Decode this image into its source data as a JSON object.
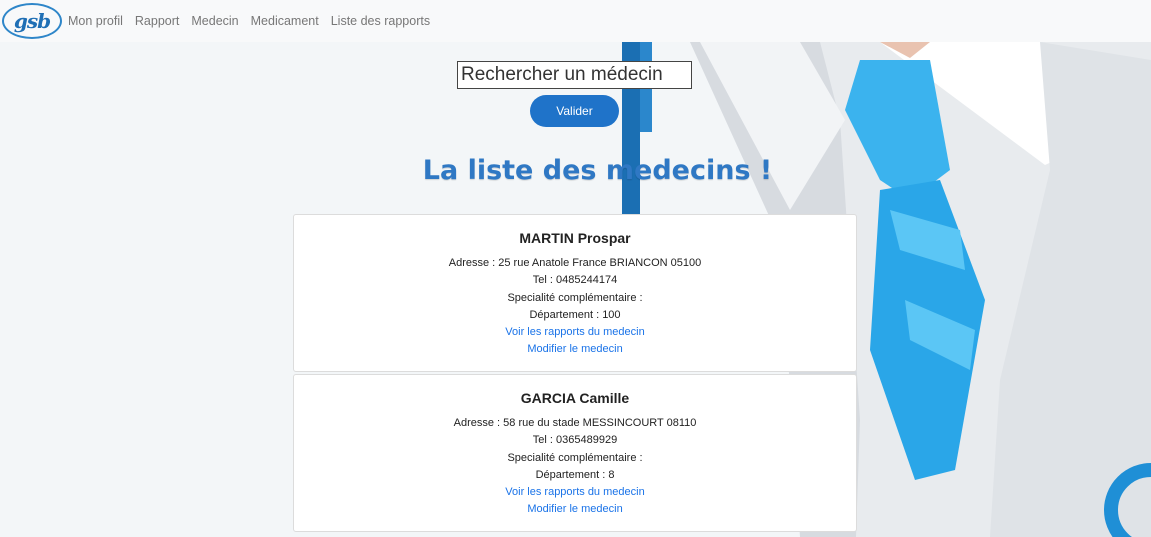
{
  "nav": {
    "logo": "gsb",
    "links": [
      "Mon profil",
      "Rapport",
      "Medecin",
      "Medicament",
      "Liste des rapports"
    ]
  },
  "search": {
    "placeholder": "Rechercher un médecin",
    "button_label": "Valider"
  },
  "page_title": "La liste des medecins !",
  "doctors": [
    {
      "name": "MARTIN Prospar",
      "address": "Adresse : 25 rue Anatole France BRIANCON 05100",
      "tel": "Tel : 0485244174",
      "specialty": "Specialité complémentaire :",
      "department": "Département : 100",
      "reports_link": "Voir les rapports du medecin",
      "edit_link": "Modifier le medecin"
    },
    {
      "name": "GARCIA Camille",
      "address": "Adresse : 58 rue du stade MESSINCOURT 08110",
      "tel": "Tel : 0365489929",
      "specialty": "Specialité complémentaire :",
      "department": "Département : 8",
      "reports_link": "Voir les rapports du medecin",
      "edit_link": "Modifier le medecin"
    }
  ],
  "colors": {
    "accent": "#1f73c9",
    "title": "#2f78c4",
    "link": "#1a73e8",
    "tie": "#2aa6e8"
  }
}
